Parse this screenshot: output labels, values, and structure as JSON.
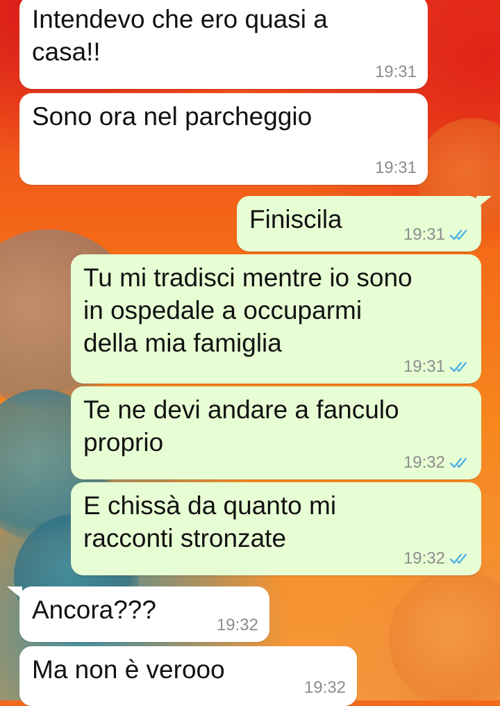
{
  "messages": [
    {
      "direction": "in",
      "text": "Intendevo che ero quasi a\ncasa!!",
      "time": "19:31"
    },
    {
      "direction": "in",
      "text": "Sono ora nel parcheggio",
      "time": "19:31"
    },
    {
      "direction": "out",
      "text": "Finiscila",
      "time": "19:31",
      "status": "read-double-check-icon"
    },
    {
      "direction": "out",
      "text": "Tu mi tradisci mentre io sono\nin ospedale a occuparmi\ndella mia famiglia",
      "time": "19:31",
      "status": "read-double-check-icon"
    },
    {
      "direction": "out",
      "text": "Te ne devi andare a fanculo\nproprio",
      "time": "19:32",
      "status": "read-double-check-icon"
    },
    {
      "direction": "out",
      "text": "E chissà da quanto mi\nracconti stronzate",
      "time": "19:32",
      "status": "read-double-check-icon"
    },
    {
      "direction": "in",
      "text": "Ancora???",
      "time": "19:32"
    },
    {
      "direction": "in",
      "text": "Ma non è verooo",
      "time": "19:32"
    }
  ],
  "colors": {
    "incoming_bubble": "#ffffff",
    "outgoing_bubble": "#e7fed4",
    "timestamp": "#8c8c8c",
    "read_tick": "#4fb3e8"
  }
}
